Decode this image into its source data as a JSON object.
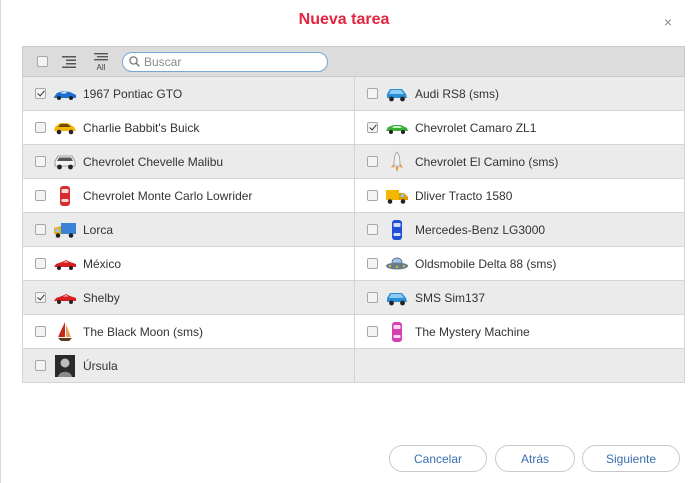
{
  "dialog": {
    "title": "Nueva tarea",
    "close": "×"
  },
  "toolbar": {
    "search_placeholder": "Buscar",
    "all_label": "All"
  },
  "items": [
    {
      "label": "1967 Pontiac GTO",
      "checked": true,
      "icon": "blue-sportscar-icon"
    },
    {
      "label": "Audi RS8 (sms)",
      "checked": false,
      "icon": "blue-car-icon"
    },
    {
      "label": "Charlie Babbit's Buick",
      "checked": false,
      "icon": "yellow-car-icon"
    },
    {
      "label": "Chevrolet Camaro ZL1",
      "checked": true,
      "icon": "green-car-icon"
    },
    {
      "label": "Chevrolet Chevelle Malibu",
      "checked": false,
      "icon": "white-car-icon"
    },
    {
      "label": "Chevrolet El Camino (sms)",
      "checked": false,
      "icon": "rocket-icon"
    },
    {
      "label": "Chevrolet Monte Carlo Lowrider",
      "checked": false,
      "icon": "red-car-topview-icon"
    },
    {
      "label": "Dliver Tracto 1580",
      "checked": false,
      "icon": "yellow-truck-icon"
    },
    {
      "label": "Lorca",
      "checked": false,
      "icon": "blue-truck-icon"
    },
    {
      "label": "Mercedes-Benz LG3000",
      "checked": false,
      "icon": "blue-car-topview-icon"
    },
    {
      "label": "México",
      "checked": false,
      "icon": "red-sportscar-icon"
    },
    {
      "label": "Oldsmobile Delta 88 (sms)",
      "checked": false,
      "icon": "ufo-icon"
    },
    {
      "label": "Shelby",
      "checked": true,
      "icon": "red-sportscar-icon"
    },
    {
      "label": "SMS Sim137",
      "checked": false,
      "icon": "blue-car-icon"
    },
    {
      "label": "The Black Moon (sms)",
      "checked": false,
      "icon": "sailboat-icon"
    },
    {
      "label": "The Mystery Machine",
      "checked": false,
      "icon": "pink-car-topview-icon"
    },
    {
      "label": "Úrsula",
      "checked": false,
      "icon": "portrait-icon"
    }
  ],
  "footer": {
    "cancel": "Cancelar",
    "back": "Atrás",
    "next": "Siguiente"
  }
}
